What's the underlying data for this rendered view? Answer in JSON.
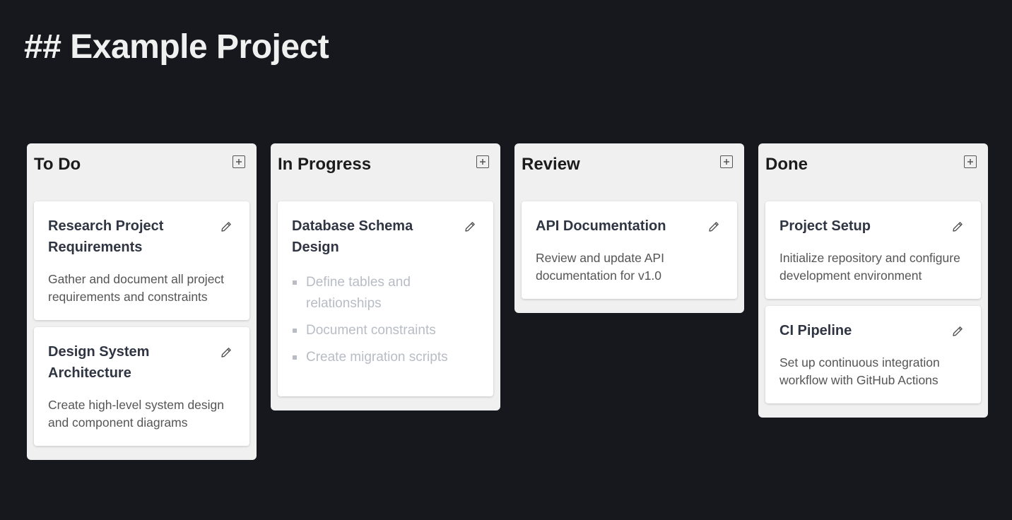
{
  "page": {
    "title": "## Example Project"
  },
  "columns": [
    {
      "title": "To Do",
      "cards": [
        {
          "title": "Research Project Requirements",
          "description": "Gather and document all project requirements and constraints"
        },
        {
          "title": "Design System Architecture",
          "description": "Create high-level system design and component diagrams"
        }
      ]
    },
    {
      "title": "In Progress",
      "cards": [
        {
          "title": "Database Schema Design",
          "checklist": [
            "Define tables and relationships",
            "Document constraints",
            "Create migration scripts"
          ]
        }
      ]
    },
    {
      "title": "Review",
      "cards": [
        {
          "title": "API Documentation",
          "description": "Review and update API documentation for v1.0"
        }
      ]
    },
    {
      "title": "Done",
      "cards": [
        {
          "title": "Project Setup",
          "description": "Initialize repository and configure development environment"
        },
        {
          "title": "CI Pipeline",
          "description": "Set up continuous integration workflow with GitHub Actions"
        }
      ]
    }
  ],
  "icons": {
    "add": "plus-square-icon",
    "edit": "pencil-icon"
  },
  "colors": {
    "background": "#16181d",
    "column": "#f0f0f0",
    "card": "#ffffff",
    "card_title": "#2f3542",
    "muted_checklist": "#b8bcc4"
  }
}
